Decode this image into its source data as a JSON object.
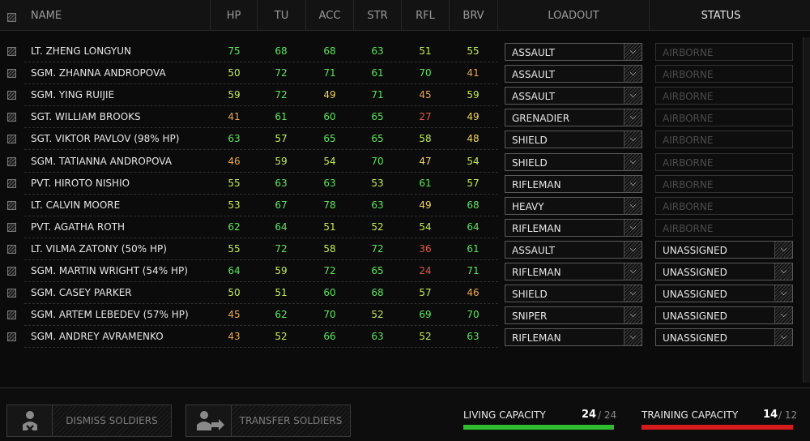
{
  "header": {
    "name": "NAME",
    "hp": "HP",
    "tu": "TU",
    "acc": "ACC",
    "str": "STR",
    "rfl": "RFL",
    "brv": "BRV",
    "loadout": "LOADOUT",
    "status": "STATUS"
  },
  "colors": {
    "high": "#5fe35f",
    "good": "#c3ea55",
    "mid": "#f1d35a",
    "low": "#e8a84e",
    "bad": "#e05a4a",
    "living_bar": "#2fbd2f",
    "training_bar": "#d41c1c"
  },
  "soldiers": [
    {
      "name": "LT. ZHENG LONGYUN",
      "hp": "75",
      "tu": "68",
      "acc": "68",
      "str": "63",
      "rfl": "51",
      "brv": "55",
      "c": [
        "high",
        "high",
        "high",
        "high",
        "good",
        "good"
      ],
      "loadout": "ASSAULT",
      "status": "AIRBORNE",
      "status_active": false
    },
    {
      "name": "SGM. ZHANNA ANDROPOVA",
      "hp": "50",
      "tu": "72",
      "acc": "71",
      "str": "61",
      "rfl": "70",
      "brv": "41",
      "c": [
        "good",
        "high",
        "high",
        "high",
        "high",
        "low"
      ],
      "loadout": "ASSAULT",
      "status": "AIRBORNE",
      "status_active": false
    },
    {
      "name": "SGM. YING RUIJIE",
      "hp": "59",
      "tu": "72",
      "acc": "49",
      "str": "71",
      "rfl": "45",
      "brv": "59",
      "c": [
        "good",
        "high",
        "mid",
        "high",
        "low",
        "good"
      ],
      "loadout": "ASSAULT",
      "status": "AIRBORNE",
      "status_active": false
    },
    {
      "name": "SGT. WILLIAM BROOKS",
      "hp": "41",
      "tu": "61",
      "acc": "60",
      "str": "65",
      "rfl": "27",
      "brv": "49",
      "c": [
        "low",
        "high",
        "high",
        "high",
        "bad",
        "mid"
      ],
      "loadout": "GRENADIER",
      "status": "AIRBORNE",
      "status_active": false
    },
    {
      "name": "SGT. VIKTOR PAVLOV (98% HP)",
      "hp": "63",
      "tu": "57",
      "acc": "65",
      "str": "65",
      "rfl": "58",
      "brv": "48",
      "c": [
        "high",
        "good",
        "high",
        "high",
        "good",
        "mid"
      ],
      "loadout": "SHIELD",
      "status": "AIRBORNE",
      "status_active": false
    },
    {
      "name": "SGM. TATIANNA ANDROPOVA",
      "hp": "46",
      "tu": "59",
      "acc": "54",
      "str": "70",
      "rfl": "47",
      "brv": "54",
      "c": [
        "low",
        "good",
        "good",
        "high",
        "mid",
        "good"
      ],
      "loadout": "SHIELD",
      "status": "AIRBORNE",
      "status_active": false
    },
    {
      "name": "PVT. HIROTO NISHIO",
      "hp": "55",
      "tu": "63",
      "acc": "63",
      "str": "53",
      "rfl": "61",
      "brv": "57",
      "c": [
        "good",
        "high",
        "high",
        "good",
        "high",
        "good"
      ],
      "loadout": "RIFLEMAN",
      "status": "AIRBORNE",
      "status_active": false
    },
    {
      "name": "LT. CALVIN MOORE",
      "hp": "53",
      "tu": "67",
      "acc": "78",
      "str": "63",
      "rfl": "49",
      "brv": "68",
      "c": [
        "good",
        "high",
        "high",
        "high",
        "mid",
        "high"
      ],
      "loadout": "HEAVY",
      "status": "AIRBORNE",
      "status_active": false
    },
    {
      "name": "PVT. AGATHA ROTH",
      "hp": "62",
      "tu": "64",
      "acc": "51",
      "str": "52",
      "rfl": "54",
      "brv": "64",
      "c": [
        "high",
        "high",
        "good",
        "good",
        "good",
        "high"
      ],
      "loadout": "RIFLEMAN",
      "status": "AIRBORNE",
      "status_active": false
    },
    {
      "name": "LT. VILMA ZATONY (50% HP)",
      "hp": "55",
      "tu": "72",
      "acc": "58",
      "str": "72",
      "rfl": "36",
      "brv": "61",
      "c": [
        "good",
        "high",
        "good",
        "high",
        "bad",
        "high"
      ],
      "loadout": "ASSAULT",
      "status": "UNASSIGNED",
      "status_active": true
    },
    {
      "name": "SGM. MARTIN WRIGHT (54% HP)",
      "hp": "64",
      "tu": "59",
      "acc": "72",
      "str": "65",
      "rfl": "24",
      "brv": "71",
      "c": [
        "high",
        "good",
        "high",
        "high",
        "bad",
        "high"
      ],
      "loadout": "RIFLEMAN",
      "status": "UNASSIGNED",
      "status_active": true
    },
    {
      "name": "SGM. CASEY PARKER",
      "hp": "50",
      "tu": "51",
      "acc": "60",
      "str": "68",
      "rfl": "57",
      "brv": "46",
      "c": [
        "good",
        "good",
        "high",
        "high",
        "good",
        "low"
      ],
      "loadout": "SHIELD",
      "status": "UNASSIGNED",
      "status_active": true
    },
    {
      "name": "SGM. ARTEM LEBEDEV (57% HP)",
      "hp": "45",
      "tu": "62",
      "acc": "70",
      "str": "52",
      "rfl": "69",
      "brv": "70",
      "c": [
        "low",
        "high",
        "high",
        "good",
        "high",
        "high"
      ],
      "loadout": "SNIPER",
      "status": "UNASSIGNED",
      "status_active": true
    },
    {
      "name": "SGM. ANDREY AVRAMENKO",
      "hp": "43",
      "tu": "52",
      "acc": "66",
      "str": "63",
      "rfl": "52",
      "brv": "63",
      "c": [
        "low",
        "good",
        "high",
        "high",
        "good",
        "high"
      ],
      "loadout": "RIFLEMAN",
      "status": "UNASSIGNED",
      "status_active": true
    }
  ],
  "footer": {
    "dismiss_label": "DISMISS SOLDIERS",
    "transfer_label": "TRANSFER SOLDIERS",
    "living_label": "LIVING CAPACITY",
    "living_value": "24",
    "living_max": "/ 24",
    "living_fraction": 1.0,
    "training_label": "TRAINING CAPACITY",
    "training_value": "14",
    "training_max": "/ 12",
    "training_fraction": 1.0
  },
  "icons": {
    "dismiss": "soldier-x-icon",
    "transfer": "soldier-transfer-icon",
    "dropdown": "chevron-down-icon"
  }
}
